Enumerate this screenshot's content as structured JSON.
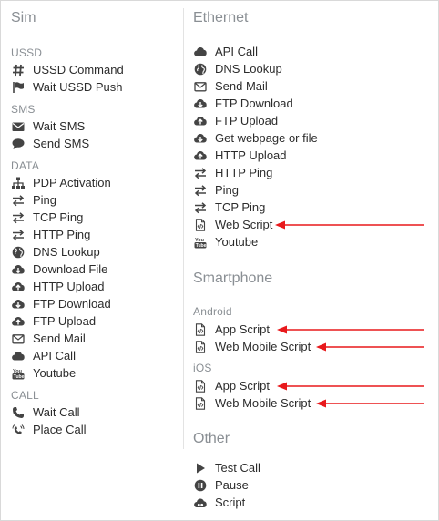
{
  "left": {
    "title": "Sim",
    "groups": [
      {
        "label": "USSD",
        "items": [
          {
            "label": "USSD Command",
            "icon": "hash-icon"
          },
          {
            "label": "Wait USSD Push",
            "icon": "flag-icon"
          }
        ]
      },
      {
        "label": "SMS",
        "items": [
          {
            "label": "Wait SMS",
            "icon": "envelope-icon"
          },
          {
            "label": "Send SMS",
            "icon": "speech-bubble-icon"
          }
        ]
      },
      {
        "label": "DATA",
        "items": [
          {
            "label": "PDP Activation",
            "icon": "sitemap-icon"
          },
          {
            "label": "Ping",
            "icon": "exchange-arrows-icon"
          },
          {
            "label": "TCP Ping",
            "icon": "exchange-arrows-icon"
          },
          {
            "label": "HTTP Ping",
            "icon": "exchange-arrows-icon"
          },
          {
            "label": "DNS Lookup",
            "icon": "globe-icon"
          },
          {
            "label": "Download File",
            "icon": "cloud-download-icon"
          },
          {
            "label": "HTTP Upload",
            "icon": "cloud-upload-icon"
          },
          {
            "label": "FTP Download",
            "icon": "cloud-download-icon"
          },
          {
            "label": "FTP Upload",
            "icon": "cloud-upload-icon"
          },
          {
            "label": "Send Mail",
            "icon": "envelope-outline-icon"
          },
          {
            "label": "API Call",
            "icon": "cloud-icon"
          },
          {
            "label": "Youtube",
            "icon": "youtube-icon"
          }
        ]
      },
      {
        "label": "CALL",
        "items": [
          {
            "label": "Wait Call",
            "icon": "phone-icon"
          },
          {
            "label": "Place Call",
            "icon": "ringing-phone-icon"
          }
        ]
      }
    ]
  },
  "right": {
    "ethernet": {
      "title": "Ethernet",
      "items": [
        {
          "label": "API Call",
          "icon": "cloud-icon"
        },
        {
          "label": "DNS Lookup",
          "icon": "globe-icon"
        },
        {
          "label": "Send Mail",
          "icon": "envelope-outline-icon"
        },
        {
          "label": "FTP Download",
          "icon": "cloud-download-icon"
        },
        {
          "label": "FTP Upload",
          "icon": "cloud-upload-icon"
        },
        {
          "label": "Get webpage or file",
          "icon": "cloud-download-icon"
        },
        {
          "label": "HTTP Upload",
          "icon": "cloud-upload-icon"
        },
        {
          "label": "HTTP Ping",
          "icon": "exchange-arrows-icon"
        },
        {
          "label": "Ping",
          "icon": "exchange-arrows-icon"
        },
        {
          "label": "TCP Ping",
          "icon": "exchange-arrows-icon"
        },
        {
          "label": "Web Script",
          "icon": "code-file-icon"
        },
        {
          "label": "Youtube",
          "icon": "youtube-icon"
        }
      ]
    },
    "smartphone": {
      "title": "Smartphone",
      "android": {
        "label": "Android",
        "items": [
          {
            "label": "App Script",
            "icon": "code-file-icon"
          },
          {
            "label": "Web Mobile Script",
            "icon": "code-file-icon"
          }
        ]
      },
      "ios": {
        "label": "iOS",
        "items": [
          {
            "label": "App Script",
            "icon": "code-file-icon"
          },
          {
            "label": "Web Mobile Script",
            "icon": "code-file-icon"
          }
        ]
      }
    },
    "other": {
      "title": "Other",
      "items": [
        {
          "label": "Test Call",
          "icon": "play-icon"
        },
        {
          "label": "Pause",
          "icon": "pause-circle-icon"
        },
        {
          "label": "Script",
          "icon": "cloud-script-icon"
        }
      ]
    }
  },
  "annotation_color": "#e8191c"
}
